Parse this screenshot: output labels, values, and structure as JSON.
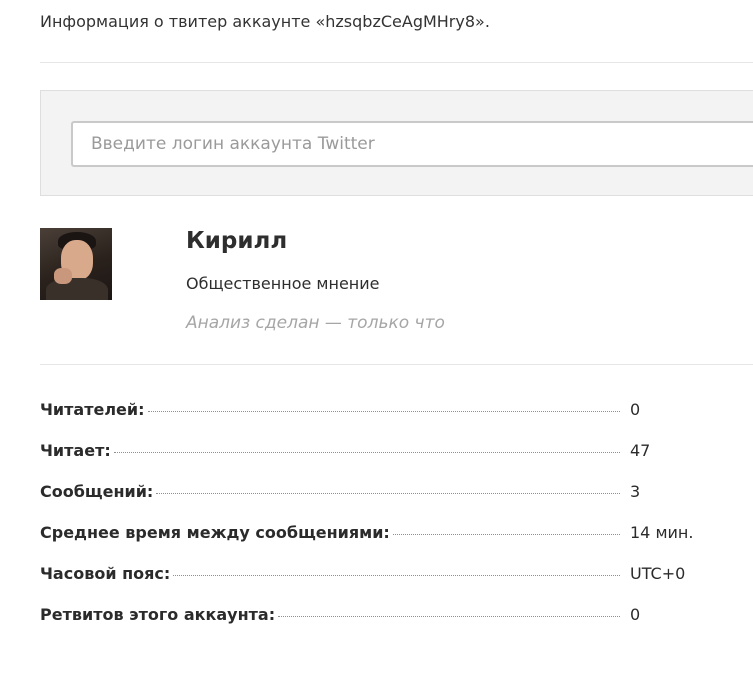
{
  "header": {
    "title": "Информация о твитер аккаунте «hzsqbzCeAgMHry8»."
  },
  "search": {
    "placeholder": "Введите логин аккаунта Twitter",
    "value": ""
  },
  "profile": {
    "name": "Кирилл",
    "description": "Общественное мнение",
    "analysis_status": "Анализ сделан — только что"
  },
  "stats": [
    {
      "label": "Читателей:",
      "value": "0"
    },
    {
      "label": "Читает:",
      "value": "47"
    },
    {
      "label": "Сообщений:",
      "value": "3"
    },
    {
      "label": "Среднее время между сообщениями:",
      "value": "14 мин."
    },
    {
      "label": "Часовой пояс:",
      "value": "UTC+0"
    },
    {
      "label": "Ретвитов этого аккаунта:",
      "value": "0"
    }
  ]
}
